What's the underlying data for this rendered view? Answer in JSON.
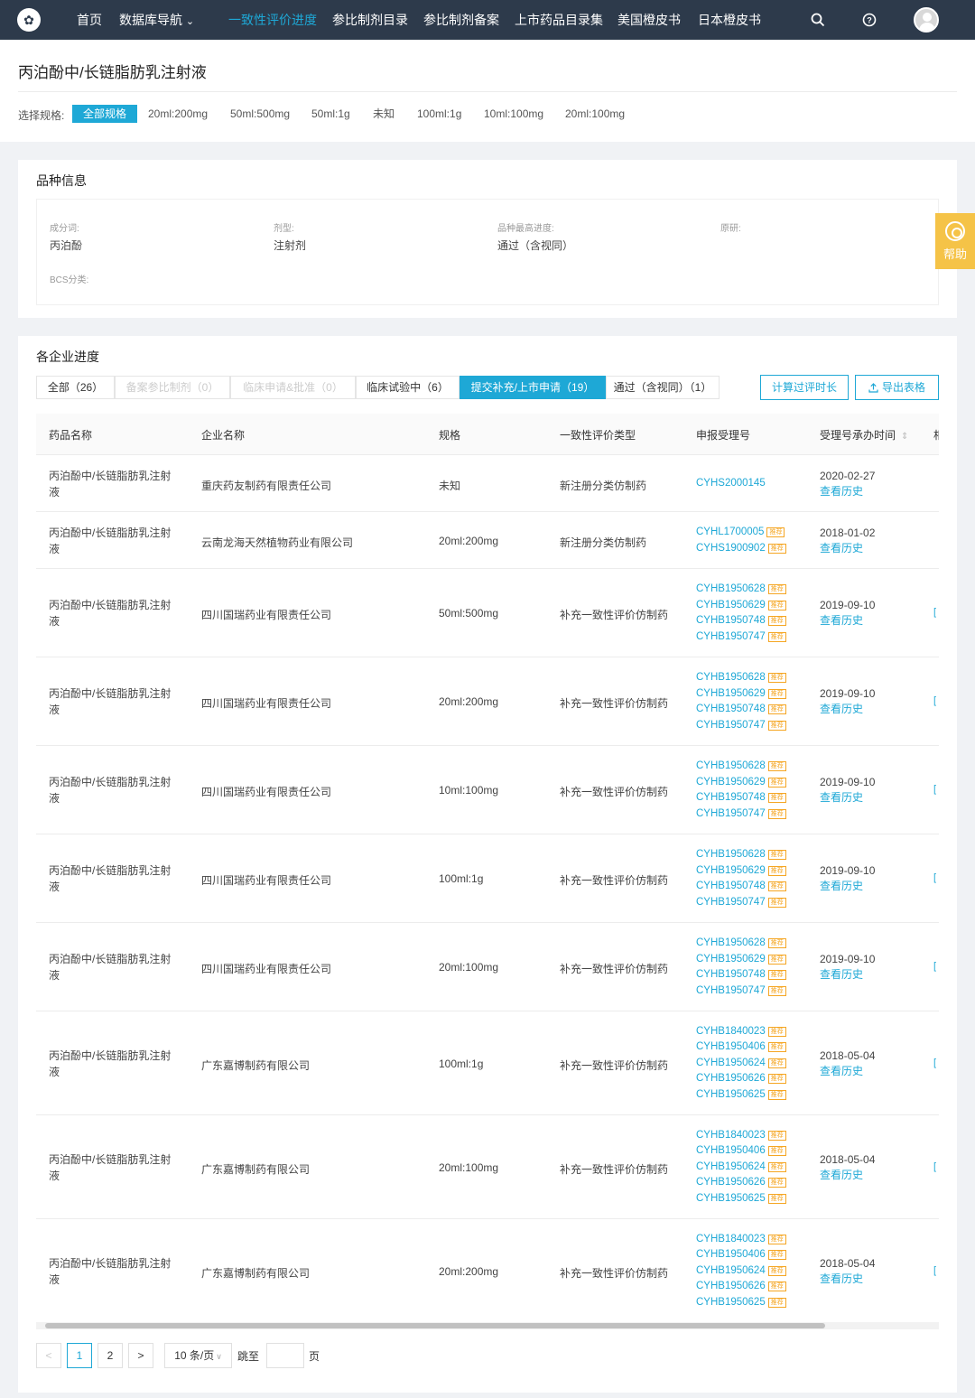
{
  "nav": {
    "items": [
      "首页",
      "数据库导航",
      "一致性评价进度",
      "参比制剂目录",
      "参比制剂备案",
      "上市药品目录集",
      "美国橙皮书",
      "日本橙皮书"
    ],
    "active_index": 2,
    "dropdown_caret": "⌄",
    "icons": [
      "search-icon",
      "help-icon",
      "user-avatar"
    ]
  },
  "page": {
    "title": "丙泊酚中/长链脂肪乳注射液"
  },
  "specs": {
    "label": "选择规格:",
    "options": [
      "全部规格",
      "20ml:200mg",
      "50ml:500mg",
      "50ml:1g",
      "未知",
      "100ml:1g",
      "10ml:100mg",
      "20ml:100mg"
    ],
    "active_index": 0
  },
  "variety": {
    "title": "品种信息",
    "fields": {
      "ingredient_label": "成分词:",
      "ingredient_value": "丙泊酚",
      "form_label": "剂型:",
      "form_value": "注射剂",
      "progress_label": "品种最高进度:",
      "progress_value": "通过（含视同）",
      "origin_label": "原研:",
      "origin_value": "",
      "bcs_label": "BCS分类:",
      "bcs_value": ""
    }
  },
  "help": {
    "label": "帮助"
  },
  "progress": {
    "title": "各企业进度",
    "tabs": [
      {
        "label": "全部（26）",
        "state": "normal"
      },
      {
        "label": "备案参比制剂（0）",
        "state": "disabled"
      },
      {
        "label": "临床申请&批准（0）",
        "state": "disabled"
      },
      {
        "label": "临床试验中（6）",
        "state": "normal"
      },
      {
        "label": "提交补充/上市申请（19）",
        "state": "active"
      },
      {
        "label": "通过（含视同）（1）",
        "state": "normal"
      }
    ],
    "calc_button": "计算过评时长",
    "export_button": "导出表格",
    "columns": [
      "药品名称",
      "企业名称",
      "规格",
      "一致性评价类型",
      "申报受理号",
      "受理号承办时间",
      "相"
    ],
    "sort_icon": "⇕",
    "tag_label": "推荐",
    "history_label": "查看历史",
    "rows": [
      {
        "name": "丙泊酚中/长链脂肪乳注射液",
        "company": "重庆药友制药有限责任公司",
        "spec": "未知",
        "type": "新注册分类仿制药",
        "apps": [
          [
            "CYHS2000145",
            false
          ]
        ],
        "date": "2020-02-27",
        "edge": ""
      },
      {
        "name": "丙泊酚中/长链脂肪乳注射液",
        "company": "云南龙海天然植物药业有限公司",
        "spec": "20ml:200mg",
        "type": "新注册分类仿制药",
        "apps": [
          [
            "CYHL1700005",
            true
          ],
          [
            "CYHS1900902",
            true
          ]
        ],
        "date": "2018-01-02",
        "edge": ""
      },
      {
        "name": "丙泊酚中/长链脂肪乳注射液",
        "company": "四川国瑞药业有限责任公司",
        "spec": "50ml:500mg",
        "type": "补充一致性评价仿制药",
        "apps": [
          [
            "CYHB1950628",
            true
          ],
          [
            "CYHB1950629",
            true
          ],
          [
            "CYHB1950748",
            true
          ],
          [
            "CYHB1950747",
            true
          ]
        ],
        "date": "2019-09-10",
        "edge": "["
      },
      {
        "name": "丙泊酚中/长链脂肪乳注射液",
        "company": "四川国瑞药业有限责任公司",
        "spec": "20ml:200mg",
        "type": "补充一致性评价仿制药",
        "apps": [
          [
            "CYHB1950628",
            true
          ],
          [
            "CYHB1950629",
            true
          ],
          [
            "CYHB1950748",
            true
          ],
          [
            "CYHB1950747",
            true
          ]
        ],
        "date": "2019-09-10",
        "edge": "["
      },
      {
        "name": "丙泊酚中/长链脂肪乳注射液",
        "company": "四川国瑞药业有限责任公司",
        "spec": "10ml:100mg",
        "type": "补充一致性评价仿制药",
        "apps": [
          [
            "CYHB1950628",
            true
          ],
          [
            "CYHB1950629",
            true
          ],
          [
            "CYHB1950748",
            true
          ],
          [
            "CYHB1950747",
            true
          ]
        ],
        "date": "2019-09-10",
        "edge": "["
      },
      {
        "name": "丙泊酚中/长链脂肪乳注射液",
        "company": "四川国瑞药业有限责任公司",
        "spec": "100ml:1g",
        "type": "补充一致性评价仿制药",
        "apps": [
          [
            "CYHB1950628",
            true
          ],
          [
            "CYHB1950629",
            true
          ],
          [
            "CYHB1950748",
            true
          ],
          [
            "CYHB1950747",
            true
          ]
        ],
        "date": "2019-09-10",
        "edge": "["
      },
      {
        "name": "丙泊酚中/长链脂肪乳注射液",
        "company": "四川国瑞药业有限责任公司",
        "spec": "20ml:100mg",
        "type": "补充一致性评价仿制药",
        "apps": [
          [
            "CYHB1950628",
            true
          ],
          [
            "CYHB1950629",
            true
          ],
          [
            "CYHB1950748",
            true
          ],
          [
            "CYHB1950747",
            true
          ]
        ],
        "date": "2019-09-10",
        "edge": "["
      },
      {
        "name": "丙泊酚中/长链脂肪乳注射液",
        "company": "广东嘉博制药有限公司",
        "spec": "100ml:1g",
        "type": "补充一致性评价仿制药",
        "apps": [
          [
            "CYHB1840023",
            true
          ],
          [
            "CYHB1950406",
            true
          ],
          [
            "CYHB1950624",
            true
          ],
          [
            "CYHB1950626",
            true
          ],
          [
            "CYHB1950625",
            true
          ]
        ],
        "date": "2018-05-04",
        "edge": "["
      },
      {
        "name": "丙泊酚中/长链脂肪乳注射液",
        "company": "广东嘉博制药有限公司",
        "spec": "20ml:100mg",
        "type": "补充一致性评价仿制药",
        "apps": [
          [
            "CYHB1840023",
            true
          ],
          [
            "CYHB1950406",
            true
          ],
          [
            "CYHB1950624",
            true
          ],
          [
            "CYHB1950626",
            true
          ],
          [
            "CYHB1950625",
            true
          ]
        ],
        "date": "2018-05-04",
        "edge": "["
      },
      {
        "name": "丙泊酚中/长链脂肪乳注射液",
        "company": "广东嘉博制药有限公司",
        "spec": "20ml:200mg",
        "type": "补充一致性评价仿制药",
        "apps": [
          [
            "CYHB1840023",
            true
          ],
          [
            "CYHB1950406",
            true
          ],
          [
            "CYHB1950624",
            true
          ],
          [
            "CYHB1950626",
            true
          ],
          [
            "CYHB1950625",
            true
          ]
        ],
        "date": "2018-05-04",
        "edge": "["
      }
    ]
  },
  "pagination": {
    "prev": "<",
    "next": ">",
    "pages": [
      "1",
      "2"
    ],
    "current": "1",
    "page_size": "10 条/页",
    "jump_label": "跳至",
    "page_suffix": "页",
    "jump_value": ""
  },
  "colors": {
    "nav_bg": "#2d3a4b",
    "accent": "#1ea8d6",
    "tag": "#f5a623",
    "help": "#f5c347"
  }
}
